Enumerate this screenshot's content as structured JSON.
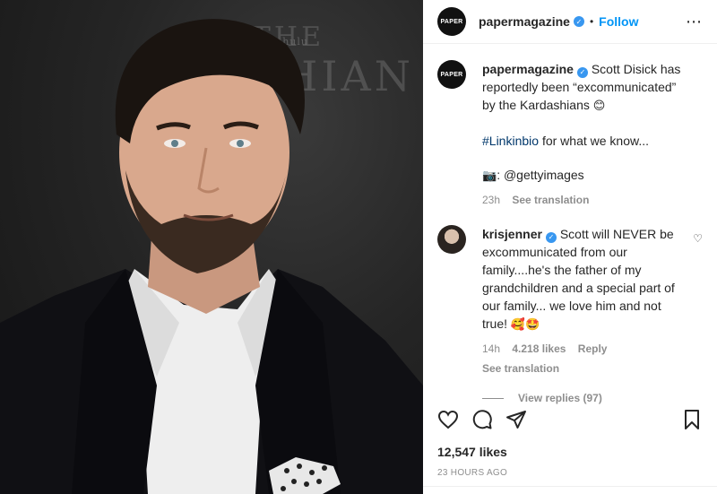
{
  "backdrop": {
    "text_small": "hulu",
    "text_row1": "THE",
    "text_row2": "SHIAN"
  },
  "header": {
    "avatar_text": "PAPER",
    "username": "papermagazine",
    "separator": "•",
    "follow_label": "Follow",
    "more_label": "⋯"
  },
  "caption": {
    "avatar_text": "PAPER",
    "username": "papermagazine",
    "line1": "Scott Disick has reportedly been “excommunicated” by the Kardashians",
    "line1_emoji": "😊",
    "hashtag": "#Linkinbio",
    "line2_rest": " for what we know...",
    "camera_emoji": "📷",
    "line3_rest": ": @gettyimages",
    "time": "23h",
    "see_translation": "See translation"
  },
  "comment": {
    "username": "krisjenner",
    "text": "Scott will NEVER be excommunicated from our family....he's the father of my grandchildren and a special part of our family... we love him and not true!",
    "emojis": "🥰🤩",
    "time": "14h",
    "likes": "4.218 likes",
    "reply": "Reply",
    "see_translation": "See translation",
    "view_replies": "View replies (97)"
  },
  "post": {
    "likes": "12,547 likes",
    "timestamp": "23 HOURS AGO"
  },
  "icons": {
    "like": "heart-icon",
    "comment": "comment-icon",
    "share": "share-icon",
    "save": "bookmark-icon"
  },
  "colors": {
    "link_blue": "#0095f6",
    "verified_blue": "#3897f0",
    "muted_gray": "#8e8e8e"
  }
}
